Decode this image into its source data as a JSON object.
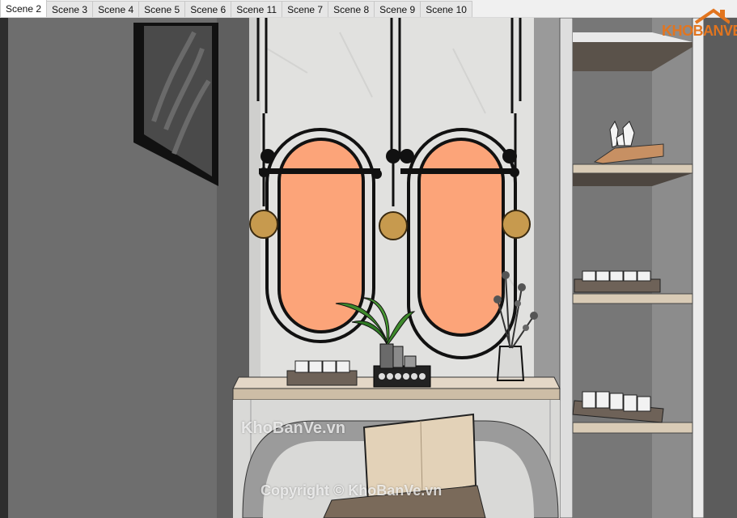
{
  "tabs": [
    "Scene 2",
    "Scene 3",
    "Scene 4",
    "Scene 5",
    "Scene 6",
    "Scene 11",
    "Scene 7",
    "Scene 8",
    "Scene 9",
    "Scene 10"
  ],
  "active_tab": "Scene 2",
  "logo": {
    "text": "KHOBANVE"
  },
  "watermarks": {
    "center": "KhoBanVe.vn",
    "copyright": "Copyright © KhoBanVe.vn"
  },
  "colors": {
    "wall": "#6f6f6f",
    "mirror_fill": "#fca479",
    "frame": "#1a1a1a",
    "marble": "#e2e2e0",
    "wood": "#d2c3b0",
    "brand": "#e2751f"
  }
}
